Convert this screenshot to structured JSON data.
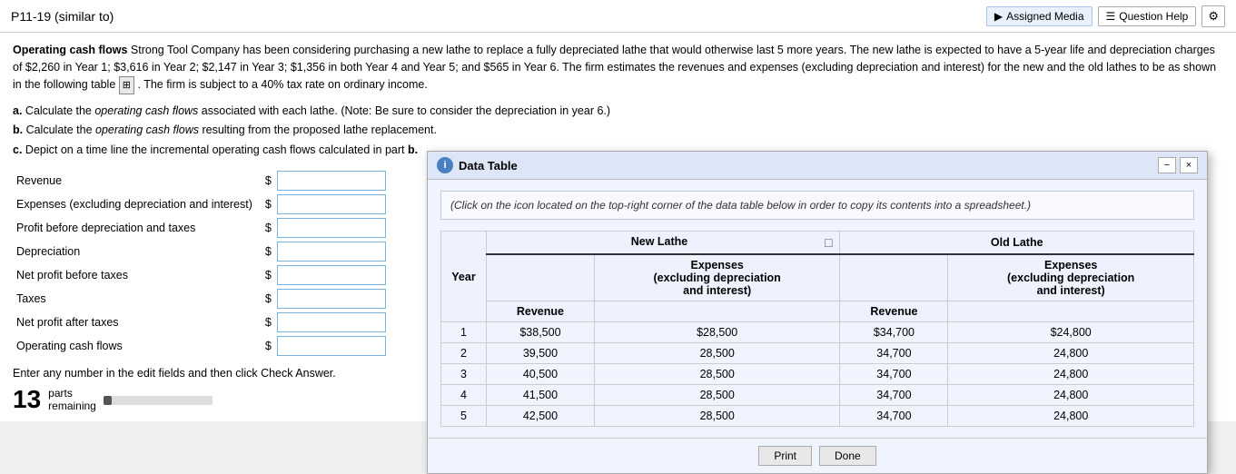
{
  "topBar": {
    "title": "P11-19 (similar to)",
    "assignedMedia": "Assigned Media",
    "questionHelp": "Question Help"
  },
  "problem": {
    "boldLabel": "Operating cash flows",
    "text1": "  Strong Tool Company has been considering purchasing a new lathe to replace a fully depreciated lathe that would otherwise last 5 more years.  The new lathe is expected to have a 5-year life and depreciation charges of $2,260 in Year 1; $3,616 in Year 2; $2,147 in Year 3; $1,356 in both Year 4 and Year 5; and $565 in Year 6.  The firm estimates the revenues and expenses (excluding depreciation and interest) for the new and the old lathes to be as shown in the following table",
    "text2": ".  The firm is subject to a 40% tax rate on ordinary income.",
    "parts": [
      {
        "label": "a.",
        "text": "Calculate the ",
        "italic": "operating cash flows",
        "text2": " associated with each lathe. (Note: Be sure to consider the depreciation in year 6.)"
      },
      {
        "label": "b.",
        "text": "Calculate the ",
        "italic": "operating cash flows",
        "text2": " resulting from the proposed lathe replacement."
      },
      {
        "label": "c.",
        "text": "Depict on a time line the incremental operating cash flows calculated in part ",
        "bold": "b."
      }
    ]
  },
  "form": {
    "rows": [
      {
        "label": "Revenue",
        "dollar": "$"
      },
      {
        "label": "Expenses (excluding depreciation and interest)",
        "dollar": "$"
      },
      {
        "label": "Profit before depreciation and taxes",
        "dollar": "$"
      },
      {
        "label": "Depreciation",
        "dollar": "$"
      },
      {
        "label": "Net profit before taxes",
        "dollar": "$"
      },
      {
        "label": "Taxes",
        "dollar": "$"
      },
      {
        "label": "Net profit after taxes",
        "dollar": "$"
      },
      {
        "label": "Operating cash flows",
        "dollar": "$"
      }
    ]
  },
  "bottomNote": "Enter any number in the edit fields and then click Check Answer.",
  "partsRemaining": {
    "number": "13",
    "label1": "parts",
    "label2": "remaining"
  },
  "modal": {
    "title": "Data Table",
    "note": "(Click on the icon located on the top-right corner of the data table below in order to copy its contents into a spreadsheet.)",
    "newLatheHeader": "New Lathe",
    "oldLatheHeader": "Old Lathe",
    "colRevenue": "Revenue",
    "colExpenses": "Expenses\n(excluding depreciation\nand interest)",
    "yearLabel": "Year",
    "rows": [
      {
        "year": "1",
        "newRevenue": "$38,500",
        "newExpenses": "$28,500",
        "oldRevenue": "$34,700",
        "oldExpenses": "$24,800"
      },
      {
        "year": "2",
        "newRevenue": "39,500",
        "newExpenses": "28,500",
        "oldRevenue": "34,700",
        "oldExpenses": "24,800"
      },
      {
        "year": "3",
        "newRevenue": "40,500",
        "newExpenses": "28,500",
        "oldRevenue": "34,700",
        "oldExpenses": "24,800"
      },
      {
        "year": "4",
        "newRevenue": "41,500",
        "newExpenses": "28,500",
        "oldRevenue": "34,700",
        "oldExpenses": "24,800"
      },
      {
        "year": "5",
        "newRevenue": "42,500",
        "newExpenses": "28,500",
        "oldRevenue": "34,700",
        "oldExpenses": "24,800"
      }
    ],
    "printBtn": "Print",
    "doneBtn": "Done"
  }
}
